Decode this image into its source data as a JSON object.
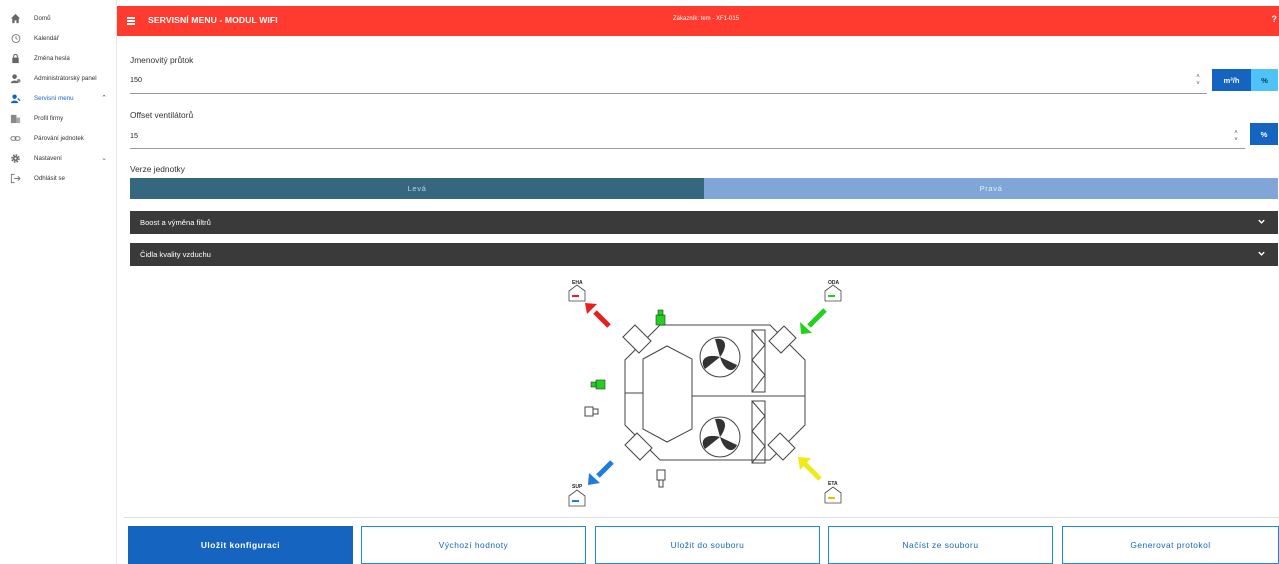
{
  "sidebar": {
    "items": [
      {
        "label": "Domů",
        "icon": "home-icon"
      },
      {
        "label": "Kalendář",
        "icon": "history-icon"
      },
      {
        "label": "Změna hesla",
        "icon": "lock-icon"
      },
      {
        "label": "Administrátorský panel",
        "icon": "admin-icon"
      },
      {
        "label": "Servisní menu",
        "icon": "service-user-icon",
        "active": true
      },
      {
        "label": "Profil firmy",
        "icon": "company-icon"
      },
      {
        "label": "Párování jednotek",
        "icon": "link-icon"
      },
      {
        "label": "Nastavení",
        "icon": "gear-icon"
      },
      {
        "label": "Odhlásit se",
        "icon": "logout-icon"
      }
    ]
  },
  "header": {
    "title": "SERVISNÍ MENU - MODUL WIFI",
    "customer": "Zákazník: tem - XF1-015",
    "help": "?"
  },
  "form": {
    "nominal_flow": {
      "label": "Jmenovitý průtok",
      "value": "150",
      "unit_primary": "m³/h",
      "unit_secondary": "%"
    },
    "fan_offset": {
      "label": "Offset ventilátorů",
      "value": "15",
      "unit": "%"
    },
    "unit_version": {
      "label": "Verze jednotky",
      "left": "Levá",
      "right": "Pravá",
      "selected": "Levá"
    }
  },
  "accordions": [
    {
      "title": "Boost a výměna filtrů"
    },
    {
      "title": "Čidla kvality vzduchu"
    }
  ],
  "diagram": {
    "labels": {
      "eha": "EHA",
      "oda": "ODA",
      "sup": "SUP",
      "eta": "ETA"
    },
    "colors": {
      "eha": "#e8201c",
      "oda": "#22d11c",
      "sup": "#1e7be0",
      "eta": "#f0ea1a"
    }
  },
  "actions": [
    {
      "label": "Uložit konfiguraci",
      "primary": true
    },
    {
      "label": "Výchozí hodnoty"
    },
    {
      "label": "Uložit do souboru"
    },
    {
      "label": "Načíst ze souboru"
    },
    {
      "label": "Generovat protokol"
    }
  ],
  "colors": {
    "header": "#ff3b30",
    "primary": "#1565c0",
    "accordion": "#3a3a3a"
  }
}
